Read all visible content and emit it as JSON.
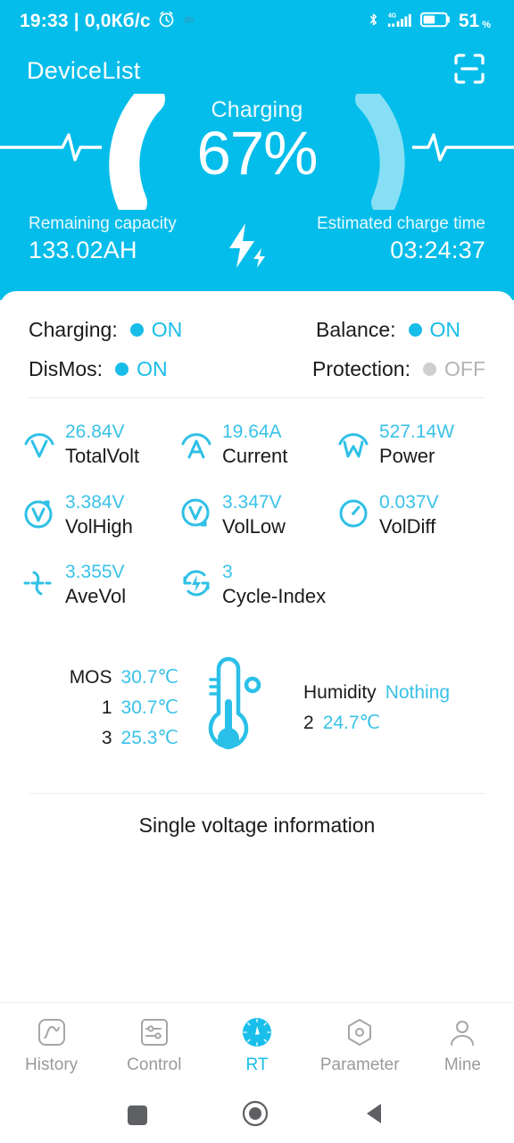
{
  "statusbar": {
    "time": "19:33 | 0,0Кб/с",
    "alarm_icon": "alarm-icon",
    "app_icon": "app-icon",
    "bluetooth_icon": "bluetooth-icon",
    "network_type": "4G",
    "signal_icon": "signal-bars-icon",
    "battery_icon": "battery-icon",
    "battery_level": "51",
    "battery_unit": "%"
  },
  "appbar": {
    "title": "DeviceList",
    "scan_icon": "scan-icon"
  },
  "hero": {
    "status_label": "Charging",
    "percent_text": "67%",
    "percent_value": 67,
    "remaining_label": "Remaining capacity",
    "remaining_value": "133.02AH",
    "estimated_label": "Estimated charge time",
    "estimated_value": "03:24:37",
    "bolt_icon": "lightning-bolt-icon",
    "accent": "#04BDEA"
  },
  "status_toggles": [
    {
      "label": "Charging:",
      "state": "ON",
      "on": true
    },
    {
      "label": "Balance:",
      "state": "ON",
      "on": true
    },
    {
      "label": "DisMos:",
      "state": "ON",
      "on": true
    },
    {
      "label": "Protection:",
      "state": "OFF",
      "on": false
    }
  ],
  "metrics": [
    {
      "value": "26.84V",
      "name": "TotalVolt",
      "icon": "volt-meter-icon"
    },
    {
      "value": "19.64A",
      "name": "Current",
      "icon": "ampere-meter-icon"
    },
    {
      "value": "527.14W",
      "name": "Power",
      "icon": "watt-meter-icon"
    },
    {
      "value": "3.384V",
      "name": "VolHigh",
      "icon": "volt-high-icon"
    },
    {
      "value": "3.347V",
      "name": "VolLow",
      "icon": "volt-low-icon"
    },
    {
      "value": "0.037V",
      "name": "VolDiff",
      "icon": "gauge-icon"
    },
    {
      "value": "3.355V",
      "name": "AveVol",
      "icon": "average-voltage-icon"
    },
    {
      "value": "3",
      "name": "Cycle-Index",
      "icon": "cycle-icon"
    }
  ],
  "temperature": {
    "thermometer_icon": "thermometer-icon",
    "left": [
      {
        "key": "MOS",
        "value": "30.7℃"
      },
      {
        "key": "1",
        "value": "30.7℃"
      },
      {
        "key": "3",
        "value": "25.3℃"
      }
    ],
    "right": [
      {
        "key": "Humidity",
        "value": "Nothing"
      },
      {
        "key": "2",
        "value": "24.7℃"
      }
    ]
  },
  "section_title": "Single voltage information",
  "tabs": [
    {
      "label": "History",
      "icon": "chart-icon",
      "active": false
    },
    {
      "label": "Control",
      "icon": "sliders-icon",
      "active": false
    },
    {
      "label": "RT",
      "icon": "gauge-dial-icon",
      "active": true
    },
    {
      "label": "Parameter",
      "icon": "hexagon-icon",
      "active": false
    },
    {
      "label": "Mine",
      "icon": "person-icon",
      "active": false
    }
  ],
  "system_nav": {
    "recents_icon": "square-icon",
    "home_icon": "circle-icon",
    "back_icon": "triangle-back-icon"
  }
}
